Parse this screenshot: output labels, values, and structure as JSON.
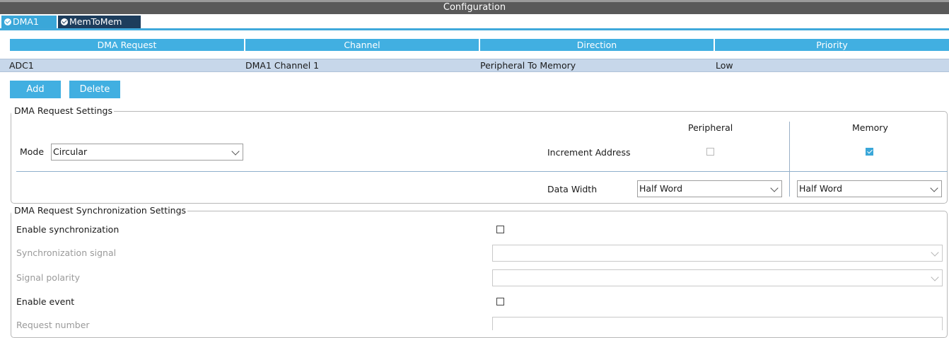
{
  "window": {
    "title": "Configuration"
  },
  "tabs": [
    {
      "label": "DMA1"
    },
    {
      "label": "MemToMem"
    }
  ],
  "table": {
    "headers": [
      "DMA Request",
      "Channel",
      "Direction",
      "Priority"
    ],
    "rows": [
      [
        "ADC1",
        "DMA1 Channel 1",
        "Peripheral To Memory",
        "Low"
      ]
    ]
  },
  "buttons": {
    "add": "Add",
    "delete": "Delete"
  },
  "request_settings": {
    "legend": "DMA Request Settings",
    "mode_label": "Mode",
    "mode_value": "Circular",
    "col_peripheral": "Peripheral",
    "col_memory": "Memory",
    "increment_label": "Increment Address",
    "peripheral_increment": false,
    "memory_increment": true,
    "data_width_label": "Data Width",
    "peripheral_width": "Half Word",
    "memory_width": "Half Word"
  },
  "sync_settings": {
    "legend": "DMA Request Synchronization Settings",
    "enable_sync_label": "Enable synchronization",
    "enable_sync": false,
    "sync_signal_label": "Synchronization signal",
    "sync_signal_value": "",
    "signal_polarity_label": "Signal polarity",
    "signal_polarity_value": "",
    "enable_event_label": "Enable event",
    "enable_event": false,
    "request_number_label": "Request number",
    "request_number_value": ""
  },
  "colors": {
    "accent": "#41afe1",
    "tab_active": "#1d3d5c",
    "row_selected": "#c7d7ea",
    "titlebar": "#595959"
  }
}
